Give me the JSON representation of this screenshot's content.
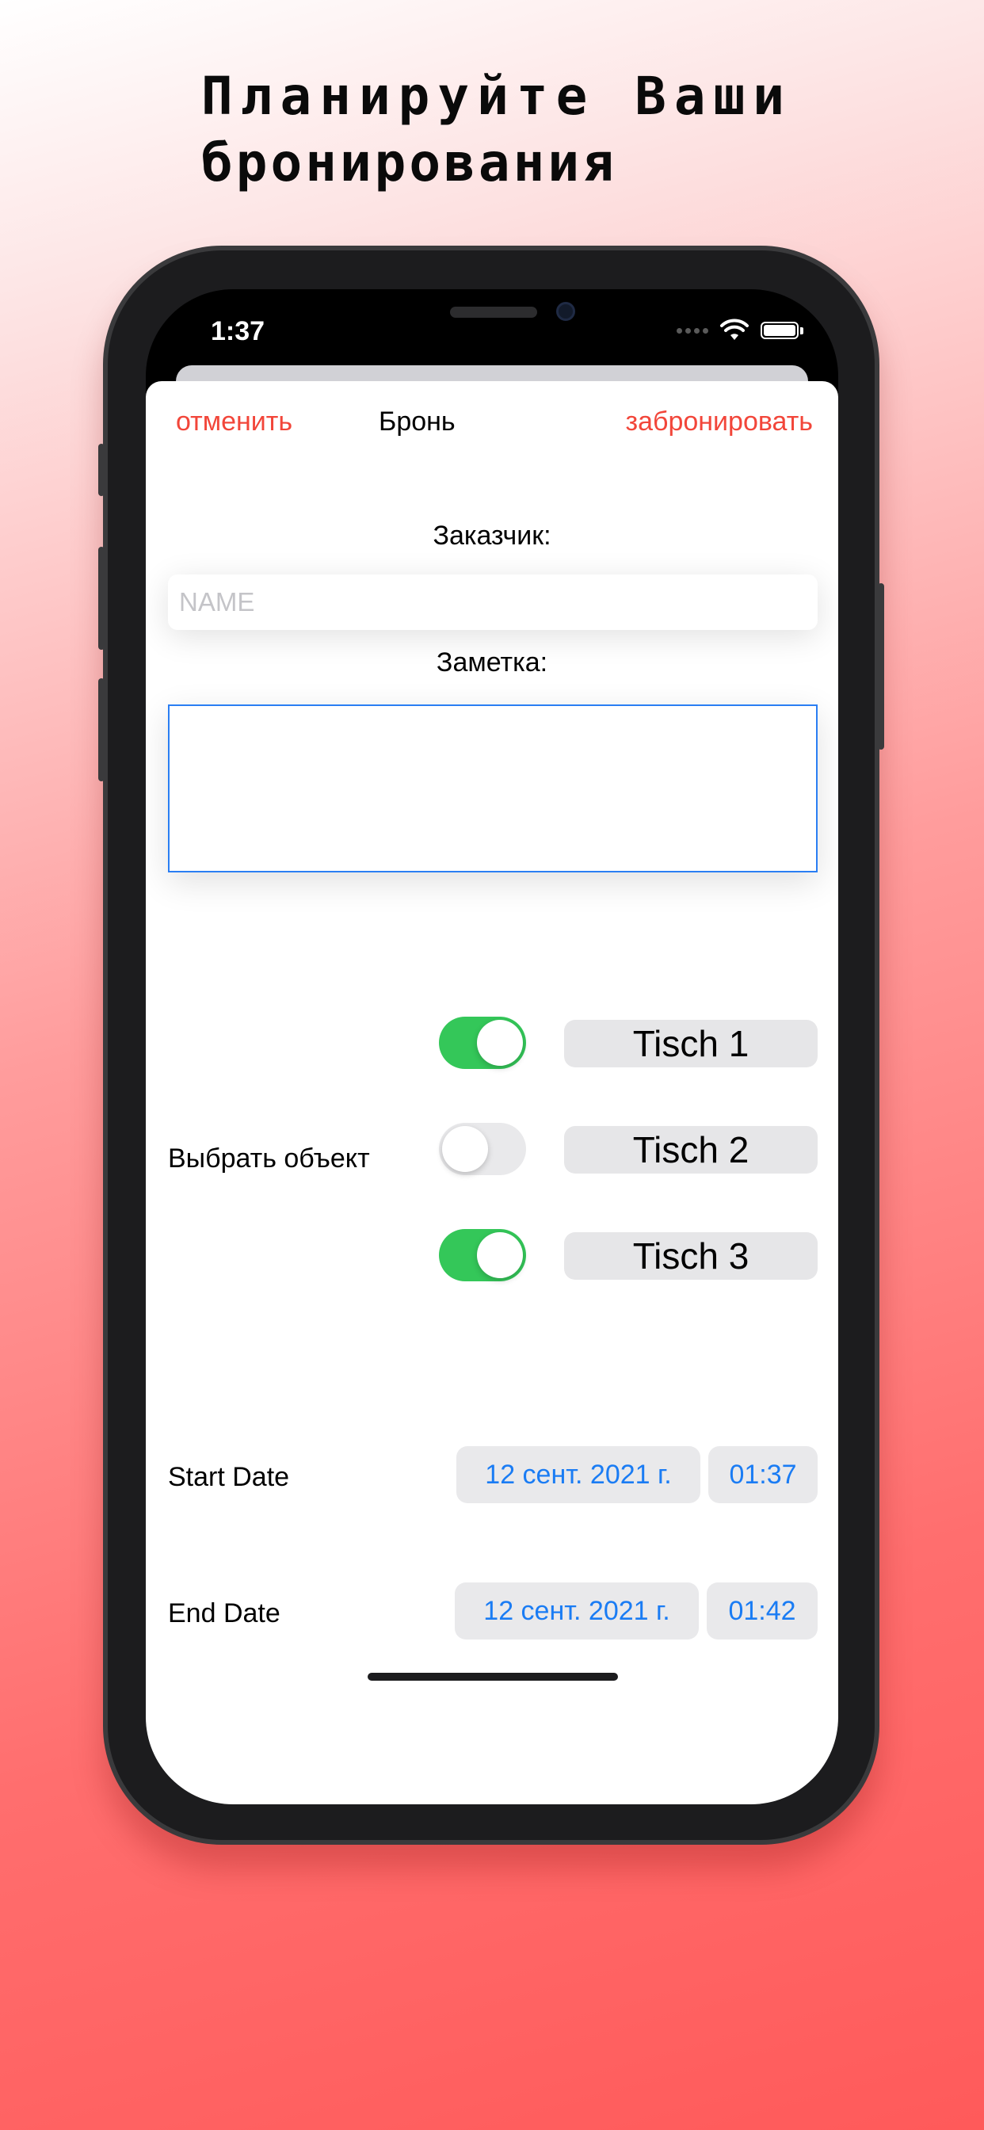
{
  "headline": {
    "line1": "Планируйте Ваши",
    "line2": "бронирования"
  },
  "status_bar": {
    "time": "1:37"
  },
  "nav": {
    "cancel_label": "отменить",
    "title": "Бронь",
    "book_label": "забронировать"
  },
  "form": {
    "customer_label": "Заказчик:",
    "name_placeholder": "NAME",
    "name_value": "",
    "note_label": "Заметка:",
    "note_value": ""
  },
  "objects": {
    "label": "Выбрать объект",
    "items": [
      {
        "name": "Tisch 1",
        "enabled": true
      },
      {
        "name": "Tisch 2",
        "enabled": false
      },
      {
        "name": "Tisch 3",
        "enabled": true
      }
    ]
  },
  "dates": {
    "start": {
      "label": "Start Date",
      "date": "12 сент. 2021 г.",
      "time": "01:37"
    },
    "end": {
      "label": "End Date",
      "date": "12 сент. 2021 г.",
      "time": "01:42"
    }
  },
  "colors": {
    "accent": "#f2463a",
    "toggle_on": "#34c759",
    "link_blue": "#1a7cf4"
  }
}
